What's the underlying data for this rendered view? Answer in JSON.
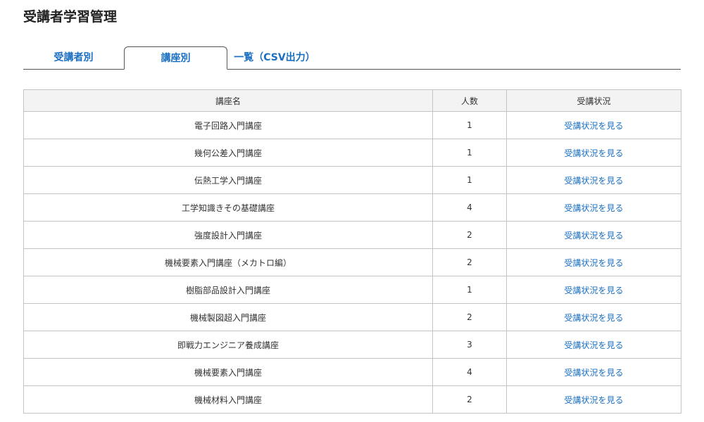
{
  "page": {
    "title": "受講者学習管理"
  },
  "tabs": [
    {
      "label": "受講者別",
      "active": false
    },
    {
      "label": "講座別",
      "active": true
    },
    {
      "label": "一覧（CSV出力）",
      "active": false
    }
  ],
  "table": {
    "headers": {
      "name": "講座名",
      "count": "人数",
      "status": "受講状況"
    },
    "rows": [
      {
        "name": "電子回路入門講座",
        "count": "1",
        "link": "受講状況を見る"
      },
      {
        "name": "幾何公差入門講座",
        "count": "1",
        "link": "受講状況を見る"
      },
      {
        "name": "伝熱工学入門講座",
        "count": "1",
        "link": "受講状況を見る"
      },
      {
        "name": "工学知識きその基礎講座",
        "count": "4",
        "link": "受講状況を見る"
      },
      {
        "name": "強度設計入門講座",
        "count": "2",
        "link": "受講状況を見る"
      },
      {
        "name": "機械要素入門講座（メカトロ編）",
        "count": "2",
        "link": "受講状況を見る"
      },
      {
        "name": "樹脂部品設計入門講座",
        "count": "1",
        "link": "受講状況を見る"
      },
      {
        "name": "機械製図超入門講座",
        "count": "2",
        "link": "受講状況を見る"
      },
      {
        "name": "即戦力エンジニア養成講座",
        "count": "3",
        "link": "受講状況を見る"
      },
      {
        "name": "機械要素入門講座",
        "count": "4",
        "link": "受講状況を見る"
      },
      {
        "name": "機械材料入門講座",
        "count": "2",
        "link": "受講状況を見る"
      }
    ]
  },
  "colors": {
    "link": "#1a6fc0",
    "header_bg": "#f3f3f3",
    "border": "#c4c4c4"
  }
}
